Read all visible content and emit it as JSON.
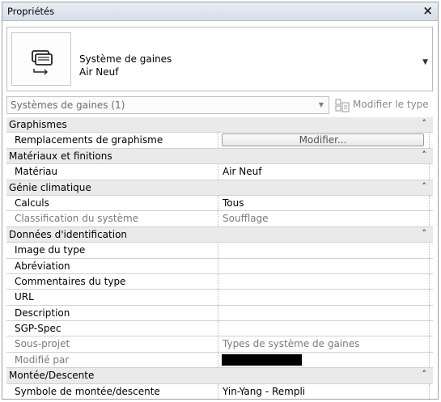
{
  "panel": {
    "title": "Propriétés",
    "close_glyph": "×"
  },
  "type_selector": {
    "family": "Système de gaines",
    "type": "Air Neuf",
    "icon": "duct-system-icon"
  },
  "filter": {
    "value": "Systèmes de gaines (1)",
    "edit_type_label": "Modifier le type"
  },
  "groups": [
    {
      "name": "Graphismes",
      "rows": [
        {
          "name": "Remplacements de graphisme",
          "button": "Modifier..."
        }
      ]
    },
    {
      "name": "Matériaux et finitions",
      "rows": [
        {
          "name": "Matériau",
          "value": "Air Neuf"
        }
      ]
    },
    {
      "name": "Génie climatique",
      "rows": [
        {
          "name": "Calculs",
          "value": "Tous"
        },
        {
          "name": "Classification du système",
          "value": "Soufflage",
          "dim": true
        }
      ]
    },
    {
      "name": "Données d'identification",
      "rows": [
        {
          "name": "Image du type",
          "value": ""
        },
        {
          "name": "Abréviation",
          "value": ""
        },
        {
          "name": "Commentaires du type",
          "value": ""
        },
        {
          "name": "URL",
          "value": ""
        },
        {
          "name": "Description",
          "value": ""
        },
        {
          "name": "SGP-Spec",
          "value": ""
        },
        {
          "name": "Sous-projet",
          "value": "Types de système de gaines",
          "dim": true
        },
        {
          "name": "Modifié par",
          "value": "",
          "redacted": true,
          "dim": true
        }
      ]
    },
    {
      "name": "Montée/Descente",
      "rows": [
        {
          "name": "Symbole de montée/descente",
          "value": "Yin-Yang - Rempli"
        }
      ]
    }
  ]
}
